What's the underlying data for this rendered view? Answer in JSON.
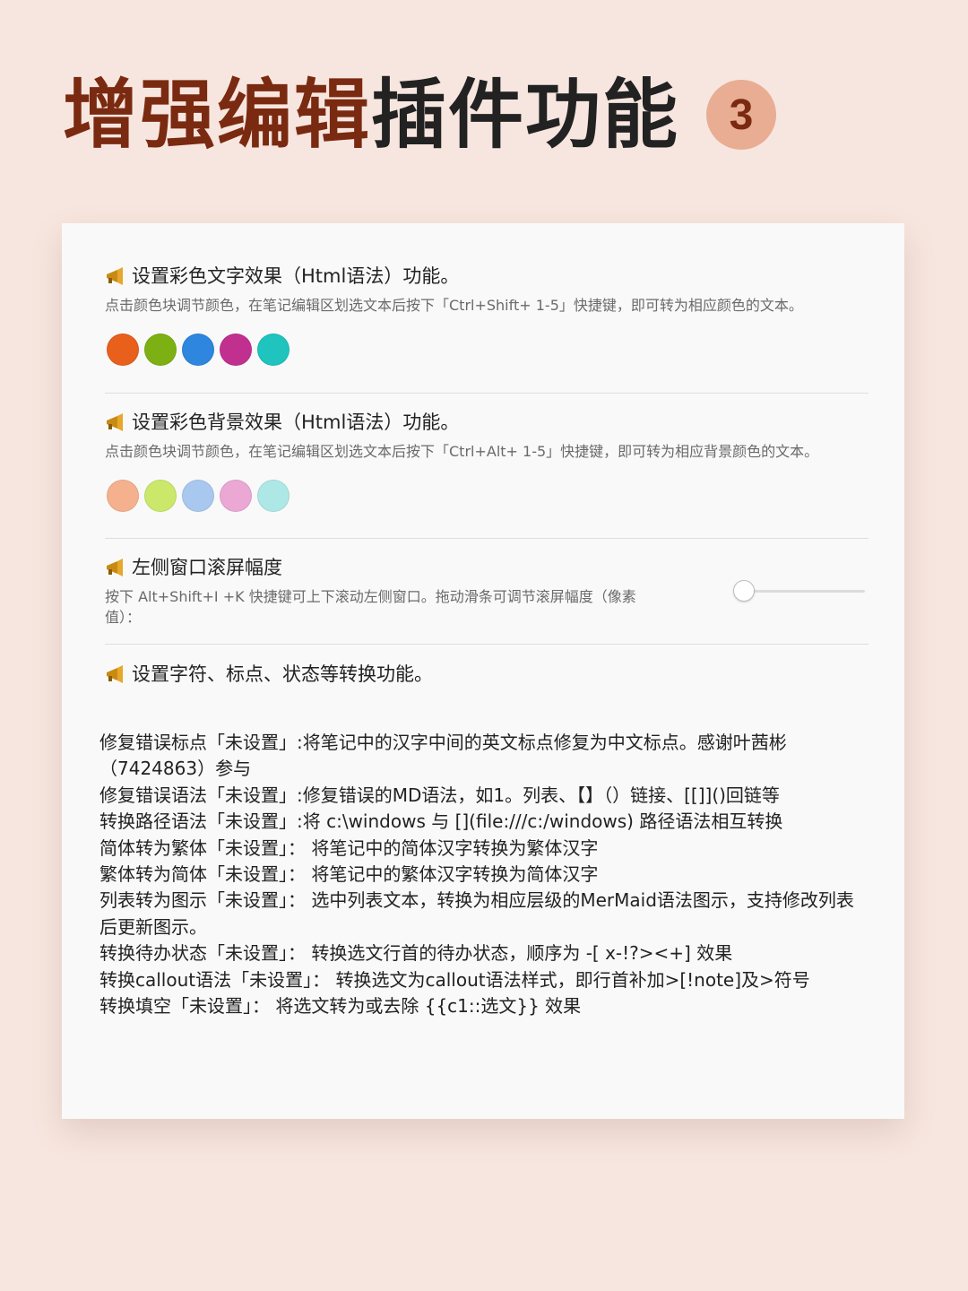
{
  "header": {
    "title_part1": "增强编辑",
    "title_part2": "插件功能",
    "badge": "3"
  },
  "sections": [
    {
      "icon": "megaphone-icon",
      "title": "设置彩色文字效果（Html语法）功能。",
      "desc": "点击颜色块调节颜色，在笔记编辑区划选文本后按下「Ctrl+Shift+ 1-5」快捷键，即可转为相应颜色的文本。",
      "swatches": [
        "#e8601c",
        "#7db012",
        "#2e86de",
        "#c2308f",
        "#1ec4bd"
      ]
    },
    {
      "icon": "megaphone-icon",
      "title": "设置彩色背景效果（Html语法）功能。",
      "desc": "点击颜色块调节颜色，在笔记编辑区划选文本后按下「Ctrl+Alt+ 1-5」快捷键，即可转为相应背景颜色的文本。",
      "swatches": [
        "#f5b18d",
        "#cbe86a",
        "#a9c8f0",
        "#eba8d5",
        "#aee8e6"
      ]
    },
    {
      "icon": "megaphone-icon",
      "title": "左侧窗口滚屏幅度",
      "desc": "按下 Alt+Shift+I +K 快捷键可上下滚动左侧窗口。拖动滑条可调节滚屏幅度（像素值）：",
      "slider_value": 0
    },
    {
      "icon": "megaphone-icon",
      "title": "设置字符、标点、状态等转换功能。"
    }
  ],
  "list_items": [
    "修复错误标点「未设置」:将笔记中的汉字中间的英文标点修复为中文标点。感谢叶茜彬（7424863）参与",
    "修复错误语法「未设置」:修复错误的MD语法，如1。列表、【】（）链接、[[]]()回链等",
    "转换路径语法「未设置」:将 c:\\windows 与 [](file:///c:/windows) 路径语法相互转换",
    "简体转为繁体「未设置」： 将笔记中的简体汉字转换为繁体汉字",
    "繁体转为简体「未设置」： 将笔记中的繁体汉字转换为简体汉字",
    "列表转为图示「未设置」： 选中列表文本，转换为相应层级的MerMaid语法图示，支持修改列表后更新图示。",
    "转换待办状态「未设置」： 转换选文行首的待办状态，顺序为 -[ x-!?><+] 效果",
    "转换callout语法「未设置」： 转换选文为callout语法样式，即行首补加>[!note]及>符号",
    "转换填空「未设置」： 将选文转为或去除 {{c1::选文}} 效果"
  ]
}
